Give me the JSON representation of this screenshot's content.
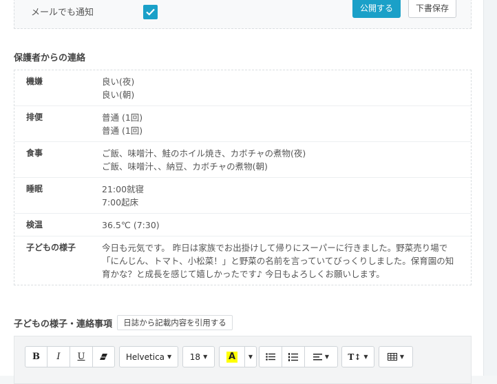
{
  "notify": {
    "email_label": "メールでも通知",
    "checked": true
  },
  "actions": {
    "publish_label": "公開する",
    "draft_label": "下書保存"
  },
  "guardian": {
    "title": "保護者からの連絡",
    "rows": [
      {
        "label": "機嫌",
        "lines": [
          "良い(夜)",
          "良い(朝)"
        ]
      },
      {
        "label": "排便",
        "lines": [
          "普通 (1回)",
          "普通 (1回)"
        ]
      },
      {
        "label": "食事",
        "lines": [
          "ご飯、味噌汁、鮭のホイル焼き、カボチャの煮物(夜)",
          "ご飯、味噌汁、、納豆、カボチャの煮物(朝)"
        ]
      },
      {
        "label": "睡眠",
        "lines": [
          "21:00就寝",
          "7:00起床"
        ]
      },
      {
        "label": "検温",
        "lines": [
          "36.5℃ (7:30)"
        ]
      },
      {
        "label": "子どもの様子",
        "paragraph": "今日も元気です。 昨日は家族でお出掛けして帰りにスーパーに行きました。野菜売り場で「にんじん、トマト、小松菜！」と野菜の名前を言っていてびっくりしました。保育園の知育かな？と成長を感じて嬉しかったです♪ 今日もよろしくお願いします。"
      }
    ]
  },
  "child_notes": {
    "title": "子どもの様子・連絡事項",
    "quote_button": "日誌から記載内容を引用する"
  },
  "toolbar": {
    "bold": "B",
    "italic": "I",
    "underline": "U",
    "font_family": "Helvetica",
    "font_size": "18",
    "highlight_letter": "A",
    "highlight_color": "#ffff00",
    "text_size_glyph": "T↕"
  },
  "colors": {
    "accent": "#1aa0c8"
  }
}
